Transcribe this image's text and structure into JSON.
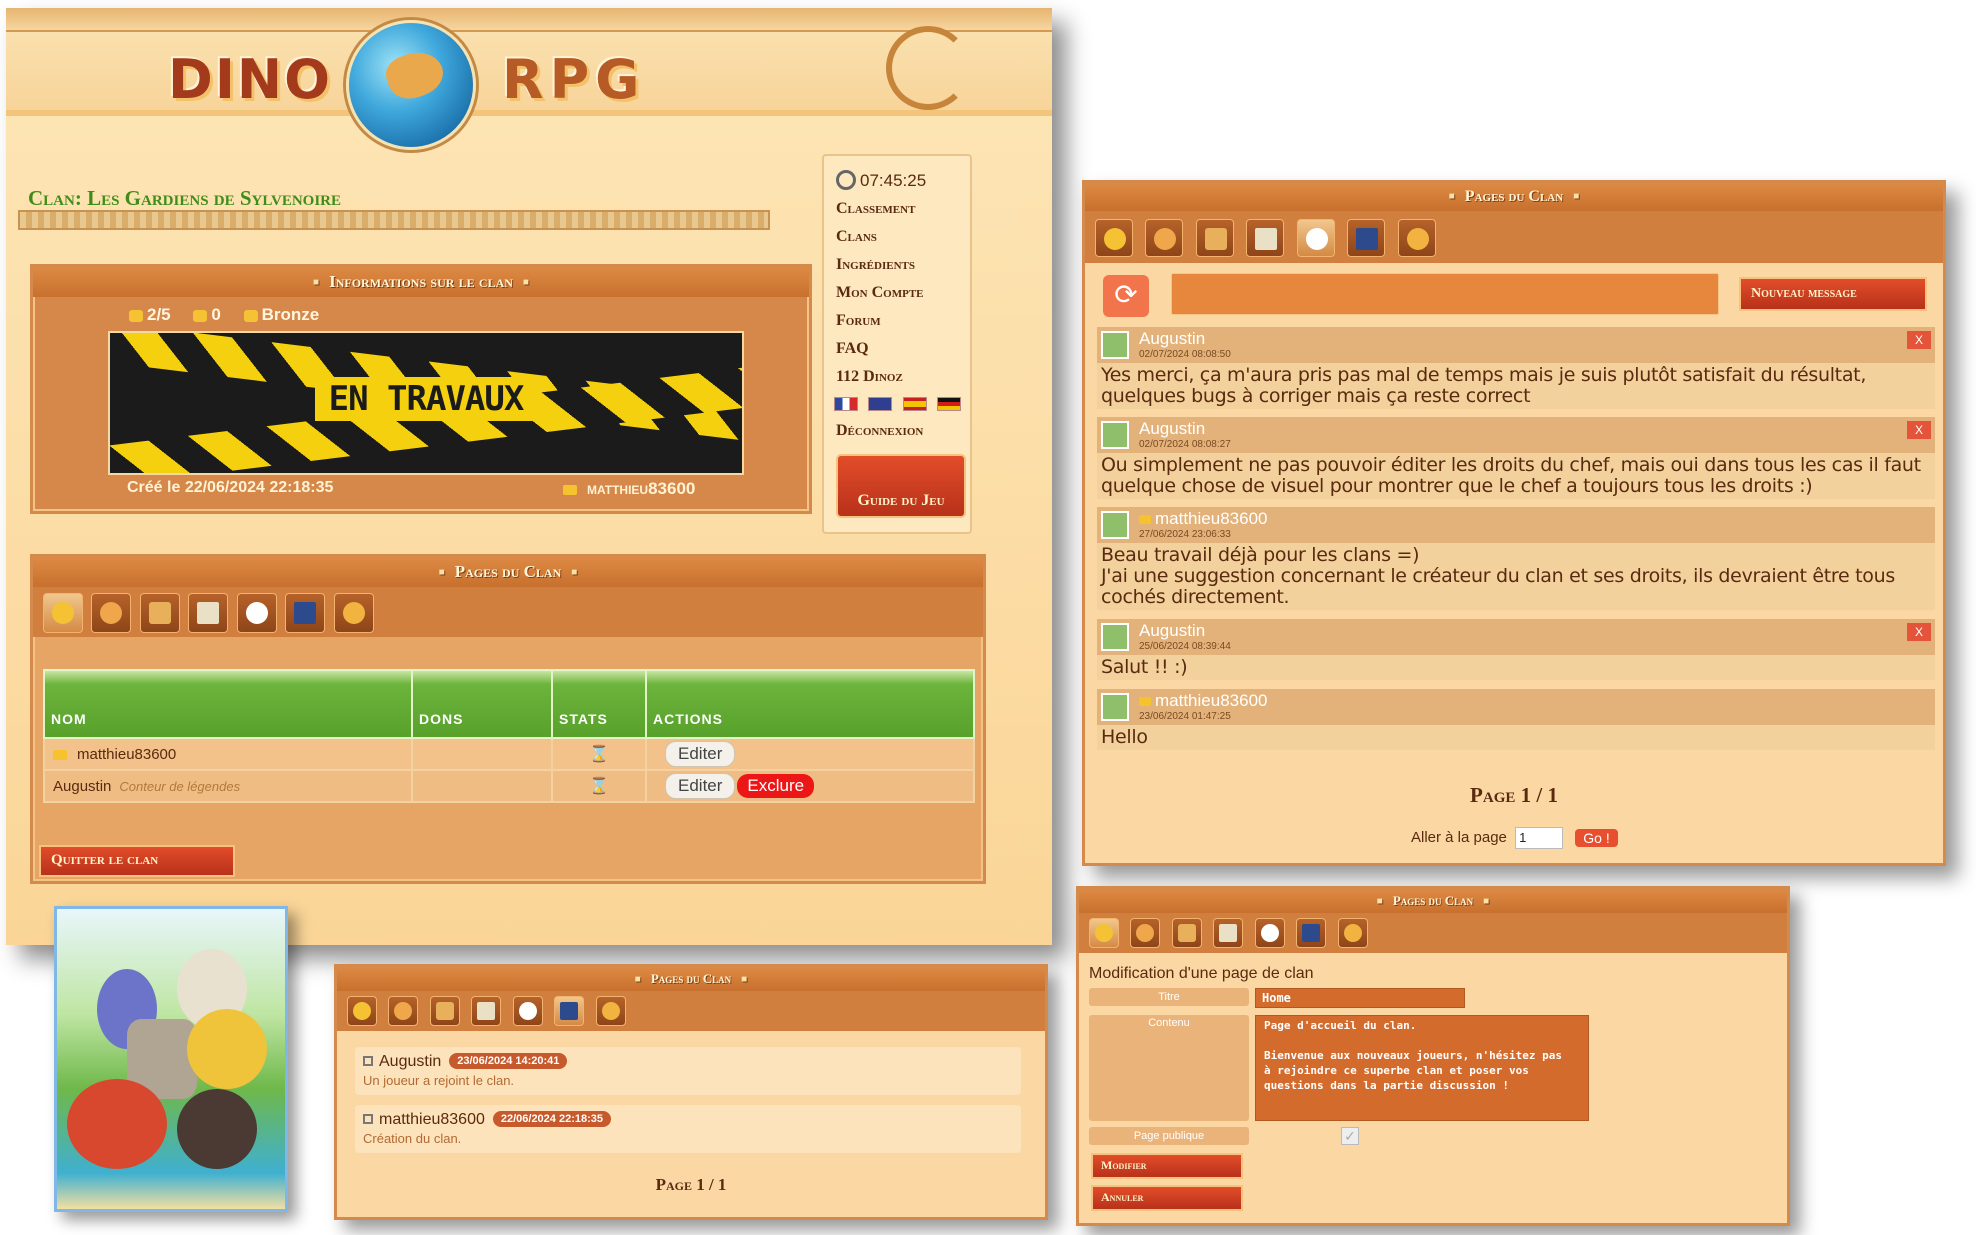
{
  "game": {
    "logo_left": "DINO",
    "logo_right": "RPG"
  },
  "clan": {
    "title": "Clan: Les Gardiens de Sylvenoire",
    "info_header": "Informations sur le clan",
    "members_count": "2/5",
    "gold": "0",
    "rank": "Bronze",
    "banner_text": "EN TRAVAUX",
    "created": "Créé le 22/06/2024 22:18:35",
    "owner": "matthieu83600"
  },
  "menu": {
    "time": "07:45:25",
    "items": [
      "Classement",
      "Clans",
      "Ingrédients",
      "Mon Compte",
      "Forum",
      "FAQ",
      "112 Dinoz",
      "Déconnexion"
    ],
    "guide_label": "Guide du Jeu"
  },
  "pages": {
    "header": "Pages du Clan",
    "columns": [
      "NOM",
      "DONS",
      "STATS",
      "ACTIONS"
    ],
    "members": [
      {
        "name": "matthieu83600",
        "role": "",
        "stats_icon": "⌛",
        "edit": "Editer",
        "exclude": ""
      },
      {
        "name": "Augustin",
        "role": "Conteur de légendes",
        "stats_icon": "⌛",
        "edit": "Editer",
        "exclude": "Exclure"
      }
    ],
    "quit_label": "Quitter le clan"
  },
  "log": {
    "header": "Pages du Clan",
    "entries": [
      {
        "name": "Augustin",
        "date": "23/06/2024 14:20:41",
        "text": "Un joueur a rejoint le clan."
      },
      {
        "name": "matthieu83600",
        "date": "22/06/2024 22:18:35",
        "text": "Création du clan."
      }
    ],
    "page_label": "Page 1 / 1"
  },
  "forum": {
    "header": "Pages du Clan",
    "refresh_icon": "⟳",
    "new_message_label": "Nouveau message",
    "close_label": "X",
    "posts": [
      {
        "author": "Augustin",
        "date": "02/07/2024 08:08:50",
        "crown": false,
        "deletable": true,
        "body": "Yes merci, ça m'aura pris pas mal de temps mais je suis plutôt satisfait du résultat, quelques bugs à corriger mais ça reste correct"
      },
      {
        "author": "Augustin",
        "date": "02/07/2024 08:08:27",
        "crown": false,
        "deletable": true,
        "body": "Ou simplement ne pas pouvoir éditer les droits du chef, mais oui dans tous les cas il faut quelque chose de visuel pour montrer que le chef a toujours tous les droits :)"
      },
      {
        "author": "matthieu83600",
        "date": "27/06/2024 23:06:33",
        "crown": true,
        "deletable": false,
        "body": "Beau travail déjà pour les clans =)\nJ'ai une suggestion concernant le créateur du clan et ses droits, ils devraient être tous cochés directement."
      },
      {
        "author": "Augustin",
        "date": "25/06/2024 08:39:44",
        "crown": false,
        "deletable": true,
        "body": "Salut !! :)"
      },
      {
        "author": "matthieu83600",
        "date": "23/06/2024 01:47:25",
        "crown": true,
        "deletable": false,
        "body": "Hello"
      }
    ],
    "page_label": "Page 1 / 1",
    "goto_label": "Aller à la page",
    "goto_value": "1",
    "goto_button": "Go !"
  },
  "edit_page": {
    "header": "Pages du Clan",
    "title": "Modification d'une page de clan",
    "titre_label": "Titre",
    "titre_value": "Home",
    "contenu_label": "Contenu",
    "contenu_value": "Page d'accueil du clan.\n\nBienvenue aux nouveaux joueurs, n'hésitez pas\nà rejoindre ce superbe clan et poser vos\nquestions dans la partie discussion !",
    "public_label": "Page publique",
    "public_checked": true,
    "check_mark": "✓",
    "modify_label": "Modifier",
    "cancel_label": "Annuler"
  },
  "colors": {
    "accent": "#d07f3f",
    "title_green": "#3f8d18",
    "button_red": "#e24d2a",
    "exclude_red": "#ec1616"
  }
}
